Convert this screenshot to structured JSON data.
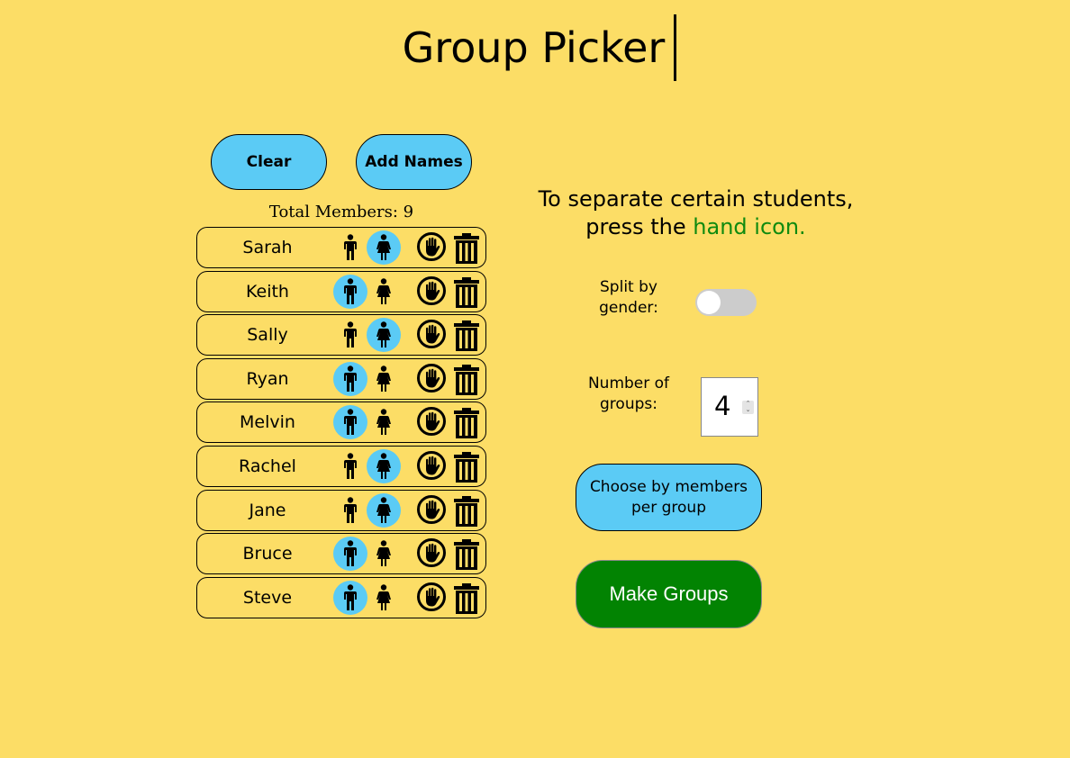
{
  "app": {
    "title": "Group Picker"
  },
  "toolbar": {
    "clear_label": "Clear",
    "add_names_label": "Add Names"
  },
  "members": {
    "total_label": "Total Members: 9",
    "list": [
      {
        "name": "Sarah",
        "gender": "female"
      },
      {
        "name": "Keith",
        "gender": "male"
      },
      {
        "name": "Sally",
        "gender": "female"
      },
      {
        "name": "Ryan",
        "gender": "male"
      },
      {
        "name": "Melvin",
        "gender": "male"
      },
      {
        "name": "Rachel",
        "gender": "female"
      },
      {
        "name": "Jane",
        "gender": "female"
      },
      {
        "name": "Bruce",
        "gender": "male"
      },
      {
        "name": "Steve",
        "gender": "male"
      }
    ],
    "row_icons": [
      "male-icon",
      "female-icon",
      "hand-icon",
      "trash-icon"
    ]
  },
  "instructions": {
    "line1": "To separate certain students,",
    "line2_prefix": "press the ",
    "line2_highlight": "hand icon."
  },
  "options": {
    "split_label": "Split by gender:",
    "split_enabled": false,
    "num_groups_label": "Number of groups:",
    "num_groups_value": "4",
    "choose_label": "Choose by members per group",
    "make_label": "Make Groups"
  },
  "colors": {
    "background": "#fcdd66",
    "accent": "#5bcbf5",
    "make_button": "#028302",
    "highlight_text": "#0f8a0f"
  }
}
